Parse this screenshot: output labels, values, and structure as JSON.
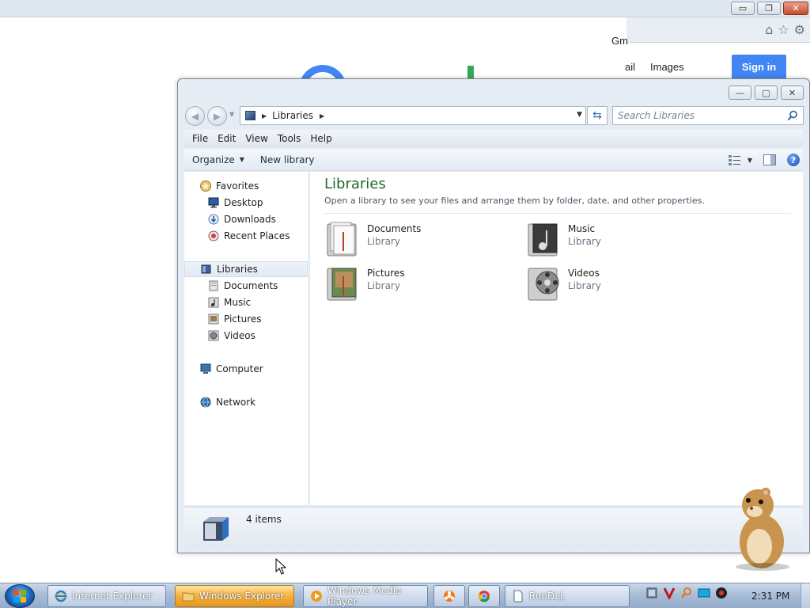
{
  "browser": {
    "gm_text": "Gm",
    "gmail_text": "ail",
    "images_text": "Images",
    "signin_label": "Sign in",
    "window_buttons": {
      "minimize": "▭",
      "restore": "❐",
      "close": "✕"
    },
    "toolbar_icons": [
      "home-icon",
      "star-icon",
      "gear-icon"
    ],
    "colors": {
      "signin": "#4285f4",
      "logo_blue": "#4285f4",
      "logo_green": "#34a853"
    }
  },
  "explorer": {
    "caption_buttons": {
      "minimize": "—",
      "maximize": "▢",
      "close": "✕"
    },
    "address": {
      "crumb": "Libraries"
    },
    "search": {
      "placeholder": "Search Libraries"
    },
    "menu": [
      "File",
      "Edit",
      "View",
      "Tools",
      "Help"
    ],
    "commands": {
      "organize": "Organize",
      "new_library": "New library"
    },
    "nav": {
      "favorites": "Favorites",
      "desktop": "Desktop",
      "downloads": "Downloads",
      "recent_places": "Recent Places",
      "libraries": "Libraries",
      "documents": "Documents",
      "music": "Music",
      "pictures": "Pictures",
      "videos": "Videos",
      "computer": "Computer",
      "network": "Network"
    },
    "content": {
      "title": "Libraries",
      "description": "Open a library to see your files and arrange them by folder, date, and other properties.",
      "libraries": [
        {
          "name": "Documents",
          "type": "Library"
        },
        {
          "name": "Music",
          "type": "Library"
        },
        {
          "name": "Pictures",
          "type": "Library"
        },
        {
          "name": "Videos",
          "type": "Library"
        }
      ]
    },
    "status": {
      "count": "4 items"
    },
    "colors": {
      "title": "#1e6b2e",
      "frame": "#e6ecf3"
    }
  },
  "taskbar": {
    "buttons": [
      {
        "label": "Internet Explorer",
        "icon": "ie-icon"
      },
      {
        "label": "Windows Explorer",
        "icon": "folder-icon",
        "active": true
      },
      {
        "label": "Windows Media Player",
        "icon": "media-player-icon"
      },
      {
        "label": "RunDLL",
        "icon": "document-icon"
      }
    ],
    "pinned": [
      "biohazard-app-icon",
      "chrome-icon"
    ],
    "tray": [
      "network-tray-icon",
      "antivirus-tray-icon",
      "search-tray-icon",
      "display-tray-icon",
      "volume-tray-icon"
    ],
    "clock": "2:31 PM"
  }
}
